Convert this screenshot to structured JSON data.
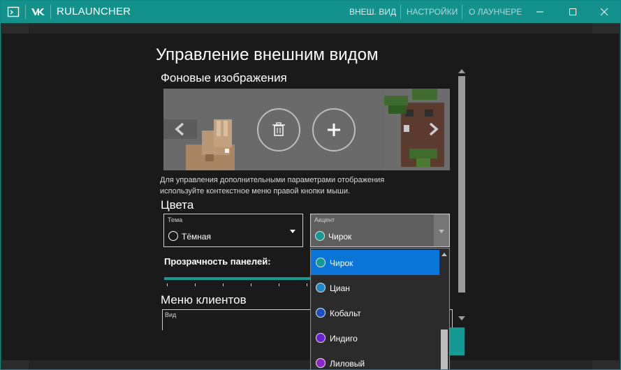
{
  "titlebar": {
    "app_name": "RULAUNCHER",
    "nav": [
      "ВНЕШ. ВИД",
      "НАСТРОЙКИ",
      "О ЛАУНЧЕРЕ"
    ],
    "bg_color": "#13928c"
  },
  "page": {
    "heading": "Управление внешним видом",
    "backgrounds_title": "Фоновые изображения",
    "help_text": "Для управления дополнительными параметрами отображения используйте контекстное меню правой кнопки мыши.",
    "colors_title": "Цвета",
    "theme_combo": {
      "label": "Тема",
      "value": "Тёмная"
    },
    "accent_combo": {
      "label": "Акцент",
      "value": "Чирок",
      "dot_color": "#139a94"
    },
    "opacity_label": "Прозрачность панелей:",
    "clients_title": "Меню клиентов",
    "view_label": "Вид"
  },
  "accent_dropdown": {
    "items": [
      {
        "label": "Чирок",
        "color": "#139a94",
        "selected": true
      },
      {
        "label": "Циан",
        "color": "#1e88c9",
        "selected": false
      },
      {
        "label": "Кобальт",
        "color": "#1a4fc4",
        "selected": false
      },
      {
        "label": "Индиго",
        "color": "#6a1fd6",
        "selected": false
      },
      {
        "label": "Лиловый",
        "color": "#8e24c9",
        "selected": false
      }
    ]
  },
  "colors": {
    "accent": "#139a94",
    "selection": "#0a74d9",
    "panel": "#1a1a1a"
  }
}
